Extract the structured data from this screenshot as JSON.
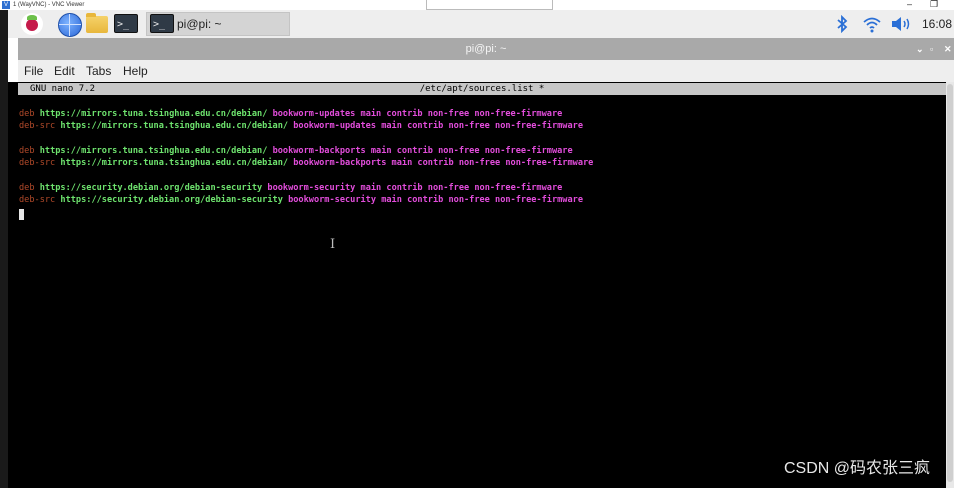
{
  "vnc_window": {
    "title": "1 (WayVNC) - VNC Viewer",
    "minimize_glyph": "–",
    "restore_glyph": "❐"
  },
  "taskbar": {
    "terminal_task_label": "pi@pi: ~",
    "clock": "16:08",
    "icons": [
      "raspberry-pi-menu-icon",
      "web-browser-icon",
      "file-manager-icon",
      "terminal-icon",
      "bluetooth-icon",
      "wifi-icon",
      "volume-icon"
    ]
  },
  "terminal_window": {
    "title": "pi@pi: ~",
    "controls": {
      "minimize": "⌄",
      "maximize": "▫",
      "close": "✕"
    },
    "menu": [
      "File",
      "Edit",
      "Tabs",
      "Help"
    ]
  },
  "nano": {
    "version": "GNU nano 7.2",
    "filename": "/etc/apt/sources.list *",
    "lines": [
      {
        "type": "deb",
        "url": "https://mirrors.tuna.tsinghua.edu.cn/debian/",
        "rest": "bookworm-updates main contrib non-free non-free-firmware"
      },
      {
        "type": "deb-src",
        "url": "https://mirrors.tuna.tsinghua.edu.cn/debian/",
        "rest": "bookworm-updates main contrib non-free non-free-firmware"
      },
      {
        "type": "deb",
        "url": "https://mirrors.tuna.tsinghua.edu.cn/debian/",
        "rest": "bookworm-backports main contrib non-free non-free-firmware"
      },
      {
        "type": "deb-src",
        "url": "https://mirrors.tuna.tsinghua.edu.cn/debian/",
        "rest": "bookworm-backports main contrib non-free non-free-firmware"
      },
      {
        "type": "deb",
        "url": "https://security.debian.org/debian-security",
        "rest": "bookworm-security main contrib non-free non-free-firmware"
      },
      {
        "type": "deb-src",
        "url": "https://security.debian.org/debian-security",
        "rest": "bookworm-security main contrib non-free non-free-firmware"
      }
    ]
  },
  "watermark": "CSDN @码农张三疯",
  "colors": {
    "terminal_bg": "#000000",
    "keyword": "#b24a2a",
    "url": "#6ee36e",
    "suite": "#e24ddb",
    "titlebar": "#a9a9a9",
    "taskbar": "#eeeeee"
  }
}
